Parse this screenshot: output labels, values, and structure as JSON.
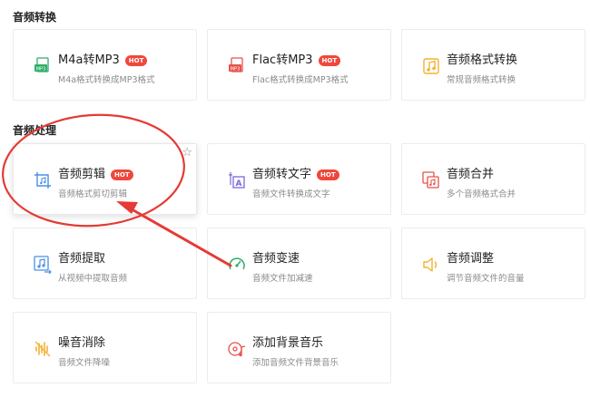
{
  "sections": [
    {
      "title": "音频转换"
    },
    {
      "title": "音频处理"
    }
  ],
  "cards": [
    {
      "title": "M4a转MP3",
      "desc": "M4a格式转换成MP3格式",
      "hot": "HOT",
      "icon": "m4a-to-mp3-icon",
      "color": "#2fae68"
    },
    {
      "title": "Flac转MP3",
      "desc": "Flac格式转换成MP3格式",
      "hot": "HOT",
      "icon": "flac-to-mp3-icon",
      "color": "#e8524a"
    },
    {
      "title": "音频格式转换",
      "desc": "常规音频格式转换",
      "icon": "audio-format-convert-icon",
      "color": "#f2b233"
    },
    {
      "title": "音频剪辑",
      "desc": "音频格式剪切剪辑",
      "hot": "HOT",
      "icon": "audio-cut-icon",
      "color": "#4a8fe6"
    },
    {
      "title": "音频转文字",
      "desc": "音频文件转换成文字",
      "hot": "HOT",
      "icon": "audio-to-text-icon",
      "color": "#7a66e0"
    },
    {
      "title": "音频合并",
      "desc": "多个音频格式合并",
      "icon": "audio-merge-icon",
      "color": "#e8524a"
    },
    {
      "title": "音频提取",
      "desc": "从视频中提取音频",
      "icon": "audio-extract-icon",
      "color": "#4a8fe6"
    },
    {
      "title": "音频变速",
      "desc": "音频文件加减速",
      "icon": "audio-speed-icon",
      "color": "#2fae68"
    },
    {
      "title": "音频调整",
      "desc": "调节音频文件的音量",
      "icon": "volume-adjust-icon",
      "color": "#f2b233"
    },
    {
      "title": "噪音消除",
      "desc": "音频文件降噪",
      "icon": "noise-reduce-icon",
      "color": "#f2b233"
    },
    {
      "title": "添加背景音乐",
      "desc": "添加音频文件背景音乐",
      "icon": "add-bgm-icon",
      "color": "#e8524a"
    }
  ],
  "favorite_icon": "☆",
  "annotation_color": "#e53a35"
}
